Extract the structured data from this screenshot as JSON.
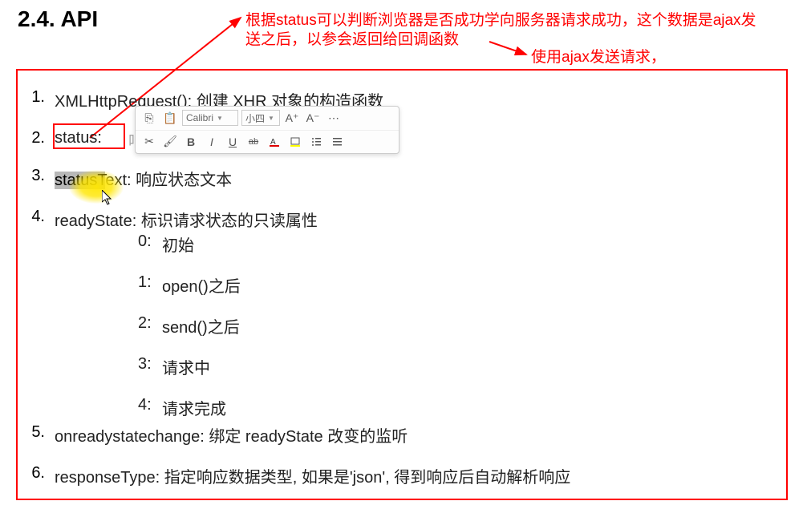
{
  "title": "2.4. API",
  "annotation_line1": "根据status可以判断浏览器是否成功学向服务器请求成功，这个数据是ajax发",
  "annotation_line2": "送之后，以参会返回给回调函数",
  "annotation_right": "使用ajax发送请求，",
  "items": [
    {
      "num": "1.",
      "text": "XMLHttpRequest():  创建 XHR 对象的构造函数"
    },
    {
      "num": "2.",
      "text": "status:"
    },
    {
      "num": "3.",
      "text_prefix": "statusT",
      "text_suffix": "ext:  响应状态文本"
    },
    {
      "num": "4.",
      "text": "readyState:  标识请求状态的只读属性"
    },
    {
      "num": "5.",
      "text": "onreadystatechange:  绑定 readyState 改变的监听"
    },
    {
      "num": "6.",
      "text": "responseType:  指定响应数据类型, 如果是'json', 得到响应后自动解析响应"
    }
  ],
  "status_faded": "响应状态码值，比如 200, 404",
  "sub_items": [
    {
      "num": "0:",
      "text": "初始"
    },
    {
      "num": "1:",
      "text": "open()之后"
    },
    {
      "num": "2:",
      "text": "send()之后"
    },
    {
      "num": "3:",
      "text": "请求中"
    },
    {
      "num": "4:",
      "text": "请求完成"
    }
  ],
  "toolbar": {
    "font": "Calibri",
    "size": "小四",
    "copy": "⎘",
    "paste": "📋",
    "cut": "✂",
    "brush": "🖌",
    "bold": "B",
    "italic": "I",
    "underline": "U",
    "strike": "ab",
    "inc": "A⁺",
    "dec": "A⁻",
    "more": "⋯"
  }
}
